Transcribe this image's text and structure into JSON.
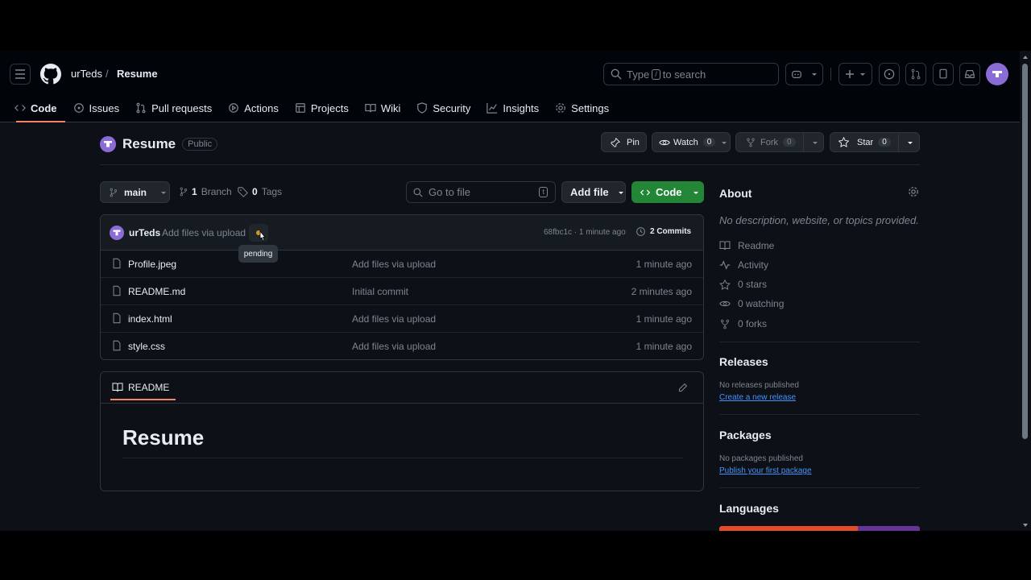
{
  "header": {
    "owner": "urTeds",
    "separator": "/",
    "repo": "Resume",
    "search_prefix": "Type",
    "search_key": "/",
    "search_suffix": "to search"
  },
  "tabs": [
    {
      "label": "Code",
      "icon": "code-icon"
    },
    {
      "label": "Issues",
      "icon": "issue-icon"
    },
    {
      "label": "Pull requests",
      "icon": "pull-request-icon"
    },
    {
      "label": "Actions",
      "icon": "play-icon"
    },
    {
      "label": "Projects",
      "icon": "table-icon"
    },
    {
      "label": "Wiki",
      "icon": "book-icon"
    },
    {
      "label": "Security",
      "icon": "shield-icon"
    },
    {
      "label": "Insights",
      "icon": "graph-icon"
    },
    {
      "label": "Settings",
      "icon": "gear-icon"
    }
  ],
  "repo": {
    "name": "Resume",
    "visibility": "Public",
    "pin_label": "Pin",
    "watch_label": "Watch",
    "watch_count": "0",
    "fork_label": "Fork",
    "fork_count": "0",
    "star_label": "Star",
    "star_count": "0"
  },
  "branch": {
    "name": "main",
    "branch_count": "1",
    "branch_label": "Branch",
    "tag_count": "0",
    "tag_label": "Tags",
    "goto_placeholder": "Go to file",
    "goto_key": "t",
    "add_file_label": "Add file",
    "code_label": "Code"
  },
  "commit": {
    "author": "urTeds",
    "message": "Add files via upload",
    "status_tooltip": "pending",
    "hash_time": "68fbc1c · 1 minute ago",
    "commits_label": "2 Commits"
  },
  "files": [
    {
      "name": "Profile.jpeg",
      "message": "Add files via upload",
      "time": "1 minute ago"
    },
    {
      "name": "README.md",
      "message": "Initial commit",
      "time": "2 minutes ago"
    },
    {
      "name": "index.html",
      "message": "Add files via upload",
      "time": "1 minute ago"
    },
    {
      "name": "style.css",
      "message": "Add files via upload",
      "time": "1 minute ago"
    }
  ],
  "readme": {
    "tab_label": "README",
    "heading": "Resume"
  },
  "about": {
    "title": "About",
    "description": "No description, website, or topics provided.",
    "items": [
      {
        "label": "Readme",
        "icon": "book-icon"
      },
      {
        "label": "Activity",
        "icon": "pulse-icon"
      },
      {
        "label": "0 stars",
        "icon": "star-icon"
      },
      {
        "label": "0 watching",
        "icon": "eye-icon"
      },
      {
        "label": "0 forks",
        "icon": "fork-icon"
      }
    ]
  },
  "releases": {
    "title": "Releases",
    "empty": "No releases published",
    "link": "Create a new release"
  },
  "packages": {
    "title": "Packages",
    "empty": "No packages published",
    "link": "Publish your first package"
  },
  "languages": {
    "title": "Languages",
    "colors": [
      "#e34c26",
      "#663399"
    ]
  }
}
